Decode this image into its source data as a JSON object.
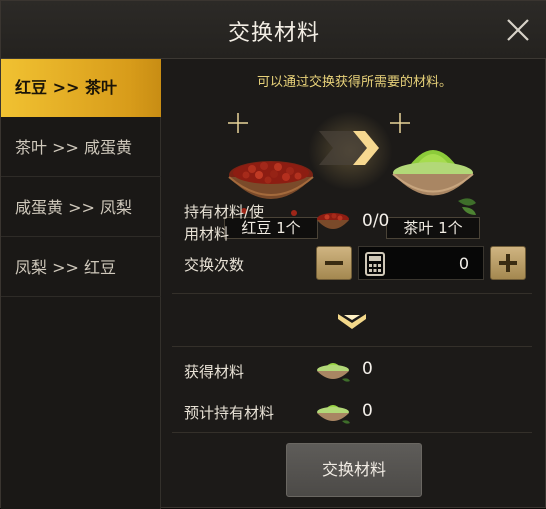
{
  "dialog": {
    "title": "交换材料"
  },
  "sidebar": {
    "items": [
      {
        "label": "红豆 >> 茶叶",
        "active": true
      },
      {
        "label": "茶叶 >> 咸蛋黄",
        "active": false
      },
      {
        "label": "咸蛋黄 >> 凤梨",
        "active": false
      },
      {
        "label": "凤梨 >> 红豆",
        "active": false
      }
    ]
  },
  "exchange": {
    "hint": "可以通过交换获得所需要的材料。",
    "from_label": "红豆 1个",
    "to_label": "茶叶 1个",
    "held_used_label": "持有材料/使用材料",
    "held_used_value": "0/0",
    "count_label": "交换次数",
    "count_value": "0",
    "obtain_label": "获得材料",
    "obtain_value": "0",
    "projected_label": "预计持有材料",
    "projected_value": "0",
    "button_label": "交换材料"
  },
  "icons": {
    "close": "close-icon",
    "minus": "minus-icon",
    "plus": "plus-icon",
    "calculator": "calculator-icon",
    "down": "chevron-down-icon",
    "red_bean": "red-bean-bowl-icon",
    "matcha": "matcha-bowl-icon"
  },
  "colors": {
    "accent_gold": "#d89c1a",
    "hint_yellow": "#e9d37a",
    "background": "#1c1a18"
  }
}
